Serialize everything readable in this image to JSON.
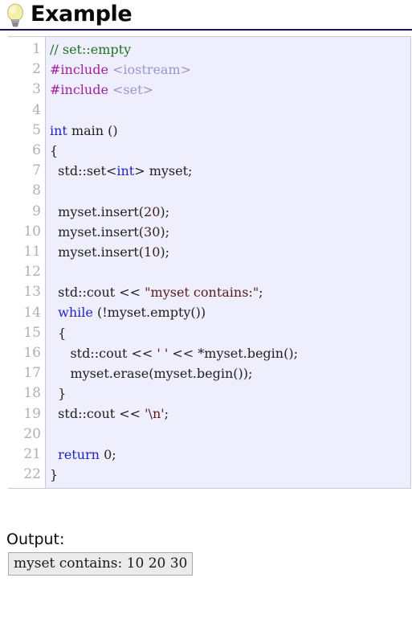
{
  "header": {
    "icon": "lightbulb-icon",
    "title": "Example",
    "rule_color": "#151560"
  },
  "code_block": {
    "background": "#eeeefc",
    "border_color": "#c9c9d8",
    "gutter_color": "#b0b0b0",
    "line_numbers": [
      "1",
      "2",
      "3",
      "4",
      "5",
      "6",
      "7",
      "8",
      "9",
      "10",
      "11",
      "12",
      "13",
      "14",
      "15",
      "16",
      "17",
      "18",
      "19",
      "20",
      "21",
      "22"
    ],
    "language": "cpp",
    "lines": [
      {
        "n": 1,
        "text": "// set::empty"
      },
      {
        "n": 2,
        "text": "#include <iostream>"
      },
      {
        "n": 3,
        "text": "#include <set>"
      },
      {
        "n": 4,
        "text": ""
      },
      {
        "n": 5,
        "text": "int main ()"
      },
      {
        "n": 6,
        "text": "{"
      },
      {
        "n": 7,
        "text": "  std::set<int> myset;"
      },
      {
        "n": 8,
        "text": ""
      },
      {
        "n": 9,
        "text": "  myset.insert(20);"
      },
      {
        "n": 10,
        "text": "  myset.insert(30);"
      },
      {
        "n": 11,
        "text": "  myset.insert(10);"
      },
      {
        "n": 12,
        "text": ""
      },
      {
        "n": 13,
        "text": "  std::cout << \"myset contains:\";"
      },
      {
        "n": 14,
        "text": "  while (!myset.empty())"
      },
      {
        "n": 15,
        "text": "  {"
      },
      {
        "n": 16,
        "text": "     std::cout << ' ' << *myset.begin();"
      },
      {
        "n": 17,
        "text": "     myset.erase(myset.begin());"
      },
      {
        "n": 18,
        "text": "  }"
      },
      {
        "n": 19,
        "text": "  std::cout << '\\n';"
      },
      {
        "n": 20,
        "text": ""
      },
      {
        "n": 21,
        "text": "  return 0;"
      },
      {
        "n": 22,
        "text": "}"
      }
    ],
    "colors": {
      "comment": "#1d7324",
      "preprocessor": "#a020a0",
      "header_name": "#9a96c8",
      "keyword": "#2222cc",
      "string": "#5c1a1a",
      "plain": "#202020"
    }
  },
  "output": {
    "label": "Output:",
    "text": "myset contains: 10 20 30",
    "border_color": "#a8a8a8",
    "background": "#ebebeb"
  }
}
